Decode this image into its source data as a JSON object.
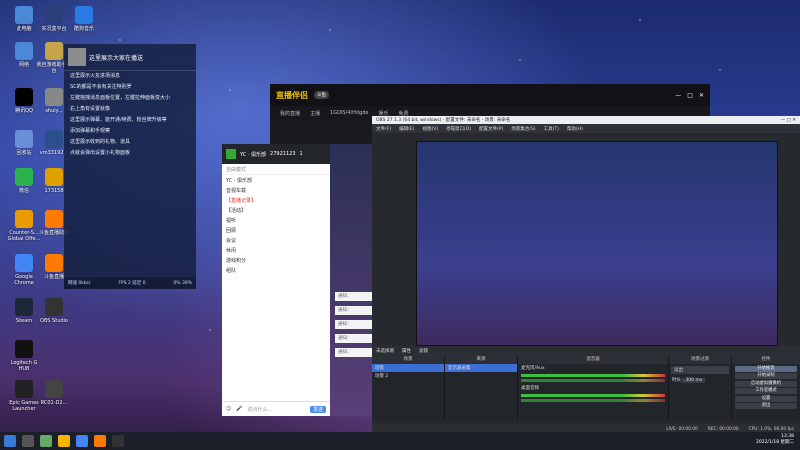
{
  "desktop_icons": [
    {
      "label": "此电脑",
      "x": 0
    },
    {
      "label": "实况盒平台",
      "x": 1
    },
    {
      "label": "酷狗音乐",
      "x": 2
    },
    {
      "label": "网络",
      "x": 3
    },
    {
      "label": "我自游戏助手平台",
      "x": 4
    },
    {
      "label": "腾讯QQ",
      "x": 5
    },
    {
      "label": "shuiy...",
      "x": 6
    },
    {
      "label": "回收站",
      "x": 7
    },
    {
      "label": "vm33192...",
      "x": 8
    },
    {
      "label": "微信",
      "x": 9
    },
    {
      "label": "173158",
      "x": 10
    },
    {
      "label": "Counter-S... Global Offe...",
      "x": 11
    },
    {
      "label": "斗鱼直播助手",
      "x": 12
    },
    {
      "label": "Google Chrome",
      "x": 13
    },
    {
      "label": "斗鱼直播",
      "x": 14
    },
    {
      "label": "Steam",
      "x": 15
    },
    {
      "label": "OBS Studio",
      "x": 16
    },
    {
      "label": "Logitech G HUB",
      "x": 17
    },
    {
      "label": "Epic Games Launcher",
      "x": 18
    },
    {
      "label": "RC01-D2...",
      "x": 19
    }
  ],
  "chat": {
    "greeting": "这里展示大家在播送",
    "messages": [
      "这里展示火友进场消息",
      "SC的都是不会有关注特别罗",
      "左键拖拽消息面板位置，左键拉伸面板变大小",
      "右上角有设置就像",
      "这里展示弹幕、能开通/续费、粉丝牌升级等",
      "添加弹幕和手观察",
      "这里展示收到的礼物、道具",
      "点就会弹出设置小礼物面板"
    ],
    "footer_left": "网速 0kb/s",
    "footer_mid": "FPS 2  延迟 0",
    "footer_right": "0%  39%"
  },
  "douyu": {
    "logo": "直播伴侣",
    "tag": "斗鱼",
    "tabs": [
      "我的直播",
      "主播",
      "1GDIS/4/Hdgde",
      "娱乐",
      "免费"
    ]
  },
  "yy": {
    "room_name": "YC · 俱乐部",
    "room_id": "27921123",
    "online": "1",
    "mode": "自由模式",
    "list": [
      "YC · 俱乐部",
      "音视车载",
      "【直播记录】",
      "【活动】",
      "视听",
      "回顾",
      "会议",
      "休闲",
      "游戏积分",
      "组队"
    ],
    "send_label": "发送",
    "composer_hint": "说点什么..."
  },
  "notices": [
    "通知：",
    "通知：",
    "通知：",
    "通知：",
    "通知："
  ],
  "obs": {
    "title": "OBS 27.1.3 (64 bit, windows) - 配置文件: 未命名 - 场景: 未命名",
    "menu": [
      "文件(F)",
      "编辑(E)",
      "视图(V)",
      "停靠窗口(D)",
      "配置文件(P)",
      "场景集合(S)",
      "工具(T)",
      "帮助(H)"
    ],
    "control_bar": [
      "未选择源",
      "属性",
      "滤镜"
    ],
    "scenes_header": "场景",
    "scenes": [
      "场景",
      "场景 2"
    ],
    "sources_header": "来源",
    "sources": [
      "显示器采集"
    ],
    "mixer_header": "混音器",
    "mixer_tracks": [
      "麦克风/Aux",
      "桌面音频"
    ],
    "transition_header": "场景过渡",
    "transition": "淡出",
    "duration_label": "时长",
    "duration_value": "300 ms",
    "controls_header": "控件",
    "controls": [
      "开始推流",
      "开始录制",
      "启动虚拟摄像机",
      "工作室模式",
      "设置",
      "退出"
    ],
    "status": [
      "LIVE: 00:00:00",
      "REC: 00:00:00",
      "CPU: 1.0%, 60.00 fps"
    ]
  },
  "taskbar": {
    "time": "13:38",
    "date": "2022/1/18 星期二"
  }
}
